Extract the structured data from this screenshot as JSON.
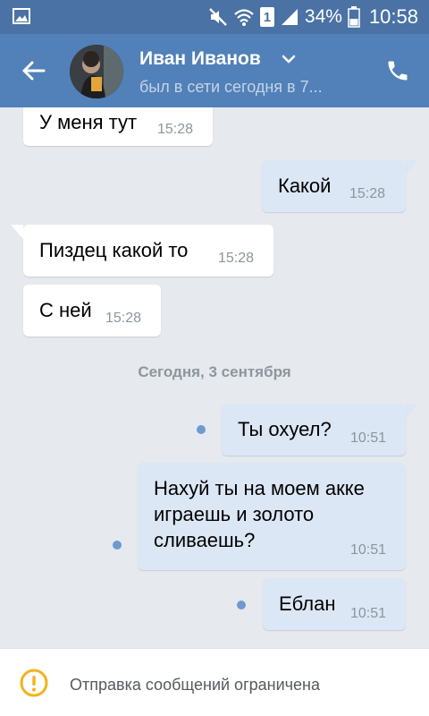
{
  "status_bar": {
    "battery": "34%",
    "time": "10:58",
    "sim": "1"
  },
  "header": {
    "name": "Иван Иванов",
    "status": "был в сети сегодня в 7..."
  },
  "messages": [
    {
      "dir": "in",
      "text": "У меня тут",
      "time": "15:28"
    },
    {
      "dir": "out",
      "text": "Какой",
      "time": "15:28"
    },
    {
      "dir": "in",
      "text": "Пиздец какой то",
      "time": "15:28"
    },
    {
      "dir": "in",
      "text": "С ней",
      "time": "15:28"
    },
    {
      "dir": "out",
      "text": "Ты охуел?",
      "time": "10:51"
    },
    {
      "dir": "out",
      "lines": [
        "Нахуй ты на моем акке",
        "играешь и золото",
        "сливаешь?"
      ],
      "time": "10:51"
    },
    {
      "dir": "out",
      "text": "Еблан",
      "time": "10:51"
    }
  ],
  "date_separator": "Сегодня, 3 сентября",
  "restriction": {
    "text": "Отправка сообщений ограничена"
  },
  "colors": {
    "header": "#5181b8",
    "status_bar": "#4a72a4",
    "outgoing": "#dce7f5",
    "incoming": "#ffffff",
    "unread_dot": "#6d9ad0",
    "warning": "#f2b31c"
  }
}
